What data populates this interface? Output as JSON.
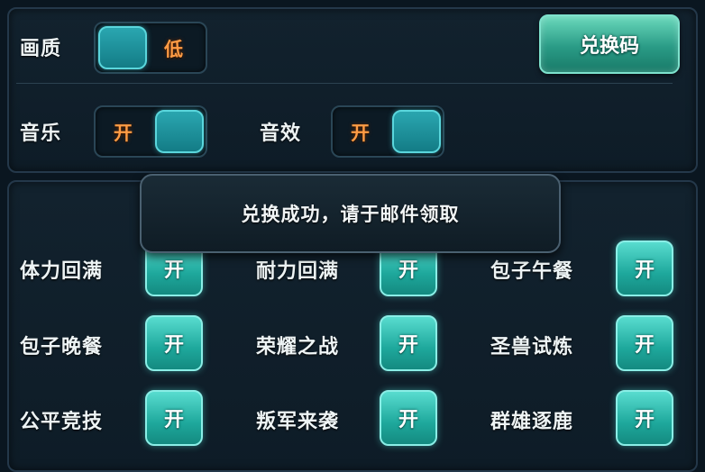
{
  "settings": {
    "quality": {
      "label": "画质",
      "value_text": "低"
    },
    "music": {
      "label": "音乐",
      "value_text": "开"
    },
    "sound": {
      "label": "音效",
      "value_text": "开"
    },
    "redeem_button_label": "兑换码"
  },
  "toast": {
    "message": "兑换成功，请于邮件领取"
  },
  "notifications": {
    "button_label": "开",
    "items": [
      {
        "label": "体力回满"
      },
      {
        "label": "耐力回满"
      },
      {
        "label": "包子午餐"
      },
      {
        "label": "包子晚餐"
      },
      {
        "label": "荣耀之战"
      },
      {
        "label": "圣兽试炼"
      },
      {
        "label": "公平竞技"
      },
      {
        "label": "叛军来袭"
      },
      {
        "label": "群雄逐鹿"
      }
    ]
  },
  "colors": {
    "accent": "#1ea89c",
    "toggle_text": "#ff9c45",
    "background": "#0a1620"
  }
}
